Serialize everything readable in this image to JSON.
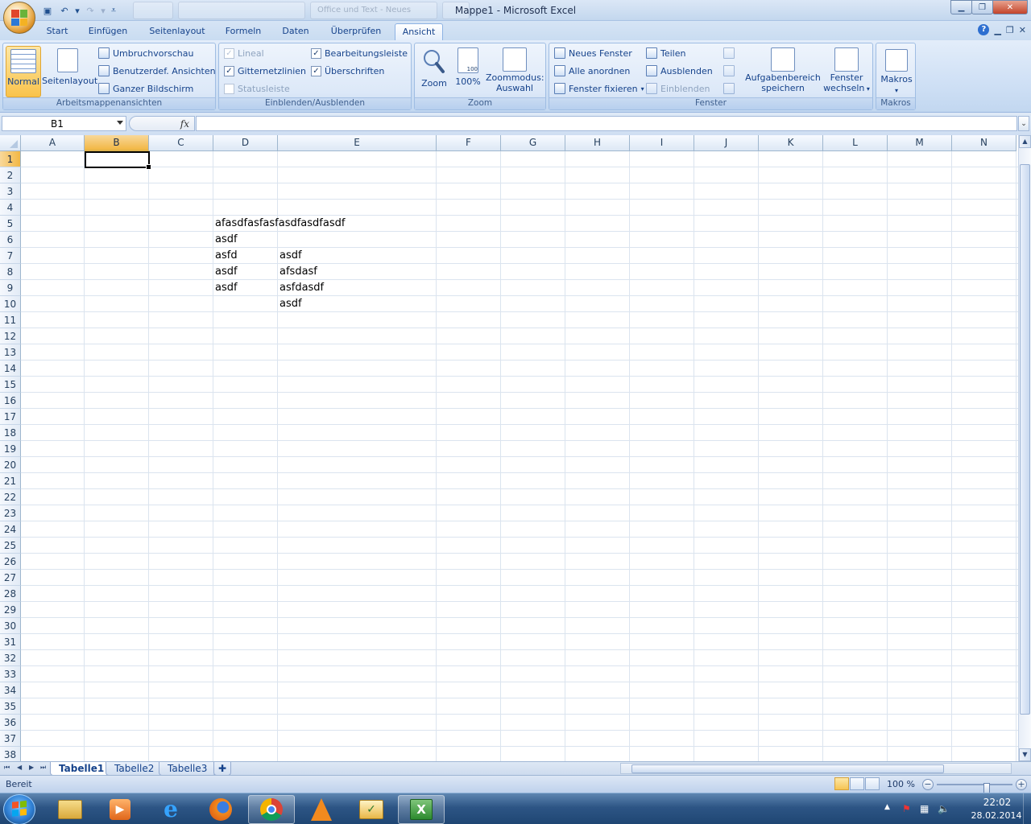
{
  "app": {
    "title": "Mappe1 - Microsoft Excel",
    "ghost_tabs": [
      "",
      "",
      "Office und Text - Neues",
      ""
    ]
  },
  "ribbon_tabs": [
    "Start",
    "Einfügen",
    "Seitenlayout",
    "Formeln",
    "Daten",
    "Überprüfen",
    "Ansicht"
  ],
  "active_tab": "Ansicht",
  "ribbon": {
    "arbeitsmappen": {
      "label": "Arbeitsmappenansichten",
      "normal": "Normal",
      "seitenlayout": "Seitenlayout",
      "umbruch": "Umbruchvorschau",
      "benutzerdef": "Benutzerdef. Ansichten",
      "ganzer": "Ganzer Bildschirm"
    },
    "einblenden": {
      "label": "Einblenden/Ausblenden",
      "lineal": "Lineal",
      "gitternetz": "Gitternetzlinien",
      "statusleiste": "Statusleiste",
      "bearbeitung": "Bearbeitungsleiste",
      "ueberschriften": "Überschriften",
      "checkmark": "✓"
    },
    "zoom": {
      "label": "Zoom",
      "zoom": "Zoom",
      "hundert": "100%",
      "icon_100": "100",
      "auswahl_1": "Zoommodus:",
      "auswahl_2": "Auswahl"
    },
    "fenster": {
      "label": "Fenster",
      "neues": "Neues Fenster",
      "alle": "Alle anordnen",
      "fixieren": "Fenster fixieren",
      "teilen": "Teilen",
      "ausblenden": "Ausblenden",
      "einblenden": "Einblenden",
      "aufgaben_1": "Aufgabenbereich",
      "aufgaben_2": "speichern",
      "wechseln_1": "Fenster",
      "wechseln_2": "wechseln"
    },
    "makros": {
      "label": "Makros",
      "makros": "Makros"
    }
  },
  "formula_bar": {
    "name_box": "B1",
    "fx": "fx",
    "content": ""
  },
  "columns": [
    "A",
    "B",
    "C",
    "D",
    "E",
    "F",
    "G",
    "H",
    "I",
    "J",
    "K",
    "L",
    "M",
    "N"
  ],
  "selected_column": "B",
  "selected_row": 1,
  "rows": [
    1,
    2,
    3,
    4,
    5,
    6,
    7,
    8,
    9,
    10,
    11,
    12,
    13,
    14,
    15,
    16,
    17,
    18,
    19,
    20,
    21,
    22,
    23,
    24,
    25,
    26,
    27,
    28,
    29,
    30,
    31,
    32,
    33,
    34,
    35,
    36,
    37,
    38
  ],
  "cells": [
    {
      "ref": "D5",
      "value": "afasdfasfasfasdfasdfasdf"
    },
    {
      "ref": "D6",
      "value": "asdf"
    },
    {
      "ref": "D7",
      "value": "asfd"
    },
    {
      "ref": "E7",
      "value": "asdf"
    },
    {
      "ref": "D8",
      "value": "asdf"
    },
    {
      "ref": "E8",
      "value": "afsdasf"
    },
    {
      "ref": "D9",
      "value": "asdf"
    },
    {
      "ref": "E9",
      "value": "asfdasdf"
    },
    {
      "ref": "E10",
      "value": "asdf"
    }
  ],
  "sheets": [
    "Tabelle1",
    "Tabelle2",
    "Tabelle3"
  ],
  "active_sheet": "Tabelle1",
  "status": {
    "text": "Bereit",
    "zoom": "100 %"
  },
  "taskbar": {
    "time": "22:02",
    "date": "28.02.2014",
    "apps": [
      "explorer-icon",
      "media-player-icon",
      "internet-explorer-icon",
      "firefox-icon",
      "chrome-icon",
      "vlc-icon",
      "outlook-icon",
      "excel-icon"
    ]
  },
  "colors": {
    "selection_header": "#f2b744",
    "ribbon_text": "#15428b",
    "taskbar": "#2d5585"
  }
}
